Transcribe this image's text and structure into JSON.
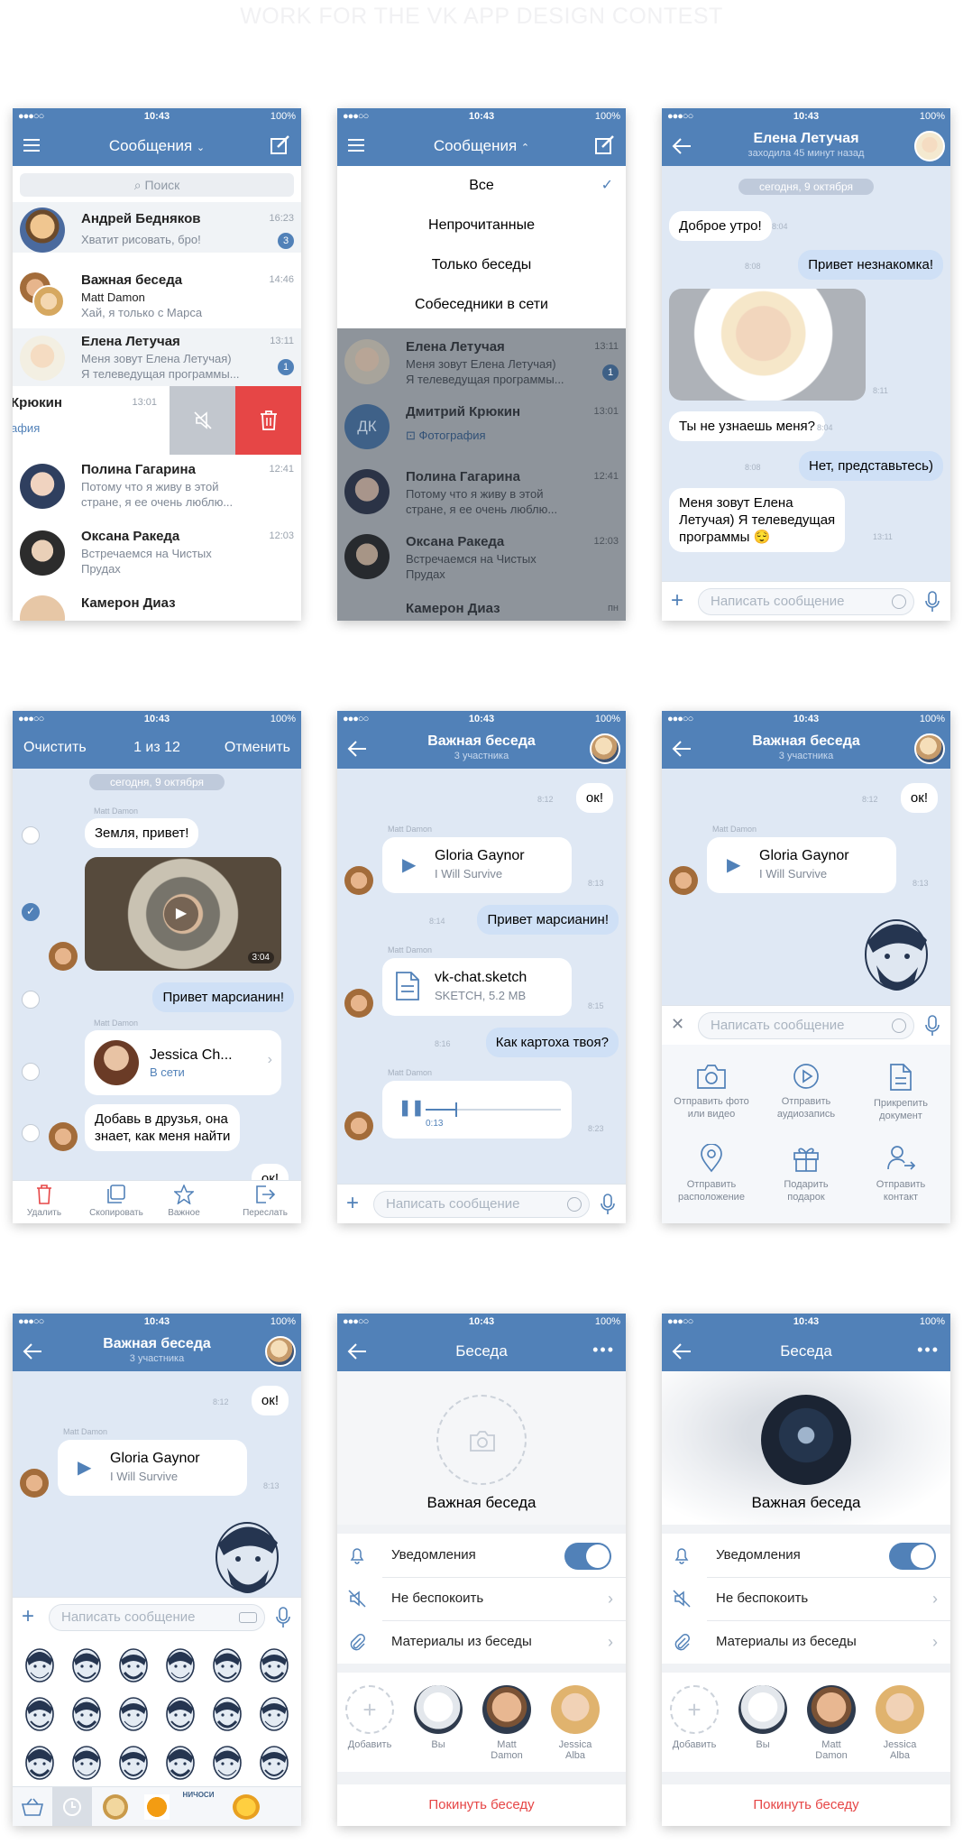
{
  "page": {
    "title": "WORK FOR THE VK APP DESIGN CONTEST"
  },
  "status": {
    "signal": "●●●○○",
    "time": "10:43",
    "battery": "100%"
  },
  "s1": {
    "title": "Сообщения",
    "search": "Поиск",
    "chats": [
      {
        "name": "Андрей Бедняков",
        "time": "16:23",
        "l1": "Хватит рисовать, бро!",
        "l2": "",
        "badge": "3"
      },
      {
        "name": "Важная беседа",
        "time": "14:46",
        "l1": "Matt Damon",
        "l2": "Хай, я только с Марса",
        "badge": ""
      },
      {
        "name": "Елена Летучая",
        "time": "13:11",
        "l1": "Меня зовут Елена Летучая)",
        "l2": "Я телеведущая программы...",
        "badge": "1"
      },
      {
        "name": "Крюкин",
        "time": "13:01",
        "l1": "афия",
        "l2": "",
        "badge": ""
      },
      {
        "name": "Полина Гагарина",
        "time": "12:41",
        "l1": "Потому что я живу в этой",
        "l2": "стране, я ее очень люблю...",
        "badge": ""
      },
      {
        "name": "Оксана Ракеда",
        "time": "12:03",
        "l1": "Встречаемся на Чистых",
        "l2": "Прудах",
        "badge": ""
      },
      {
        "name": "Камерон Диаз",
        "time": "",
        "l1": "",
        "l2": "",
        "badge": ""
      }
    ]
  },
  "s2": {
    "title": "Сообщения",
    "filters": [
      "Все",
      "Непрочитанные",
      "Только беседы",
      "Собеседники в сети"
    ],
    "chats": [
      {
        "name": "Елена Летучая",
        "time": "13:11",
        "l1": "Меня зовут Елена Летучая)",
        "l2": "Я телеведущая программы...",
        "badge": "1"
      },
      {
        "name": "Дмитрий Крюкин",
        "time": "13:01",
        "l1": "Фотография",
        "l2": "",
        "badge": "",
        "initials": "ДК"
      },
      {
        "name": "Полина Гагарина",
        "time": "12:41",
        "l1": "Потому что я живу в этой",
        "l2": "стране, я ее очень люблю...",
        "badge": ""
      },
      {
        "name": "Оксана Ракеда",
        "time": "12:03",
        "l1": "Встречаемся на Чистых",
        "l2": "Прудах",
        "badge": ""
      },
      {
        "name": "Камерон Диаз",
        "time": "пн",
        "l1": "",
        "l2": "",
        "badge": ""
      }
    ]
  },
  "s3": {
    "title": "Елена Летучая",
    "sub": "заходила 45 минут назад",
    "date": "сегодня, 9 октября",
    "m1": "Доброе утро!",
    "t1": "8:04",
    "m2": "Привет незнакомка!",
    "t2": "8:08",
    "tphoto": "8:11",
    "m3": "Ты не узнаешь меня?",
    "t3": "8:04",
    "m4": "Нет, представьтесь)",
    "t4": "8:08",
    "m5a": "Меня зовут Елена",
    "m5b": "Летучая) Я телеведущая",
    "m5c": "программы 😌",
    "t5": "13:11"
  },
  "compose": {
    "placeholder": "Написать сообщение"
  },
  "s4": {
    "clear": "Очистить",
    "count": "1 из 12",
    "cancel": "Отменить",
    "date": "сегодня, 9 октября",
    "sender": "Matt Damon",
    "m1": "Земля, привет!",
    "dur": "3:04",
    "m2": "Привет марсианин!",
    "contact": "Jessica Ch...",
    "online": "В сети",
    "m3a": "Добавь в друзья, она",
    "m3b": "знает, как меня найти",
    "m4": "ок!",
    "tools": [
      "Удалить",
      "Скопировать",
      "Важное",
      "Переслать"
    ]
  },
  "conv": {
    "title": "Важная беседа",
    "sub": "3 участника",
    "ok": "ок!",
    "tok": "8:12",
    "sender": "Matt Damon",
    "song": "Gloria Gaynor",
    "artist": "I Will Survive",
    "tsong": "8:13",
    "m2": "Привет марсианин!",
    "t2": "8:14",
    "file": "vk-chat.sketch",
    "fmeta": "SKETCH, 5.2 MB",
    "tfile": "8:15",
    "m3": "Как картоха твоя?",
    "t3": "8:16",
    "vtime": "0:13",
    "tvoice": "8:23"
  },
  "s6": {
    "attach": [
      [
        "Отправить фото",
        "или видео"
      ],
      [
        "Отправить",
        "аудиозапись"
      ],
      [
        "Прикрепить",
        "документ"
      ],
      [
        "Отправить",
        "расположение"
      ],
      [
        "Подарить",
        "подарок"
      ],
      [
        "Отправить",
        "контакт"
      ]
    ]
  },
  "s8": {
    "title": "Беседа",
    "name": "Важная беседа",
    "opts": [
      "Уведомления",
      "Не беспокоить",
      "Материалы из беседы"
    ],
    "members": [
      [
        "Добавить",
        ""
      ],
      [
        "Вы",
        ""
      ],
      [
        "Matt",
        "Damon"
      ],
      [
        "Jessica",
        "Alba"
      ]
    ],
    "leave": "Покинуть беседу"
  },
  "sticker": {
    "label": "НИЧОСИ"
  }
}
